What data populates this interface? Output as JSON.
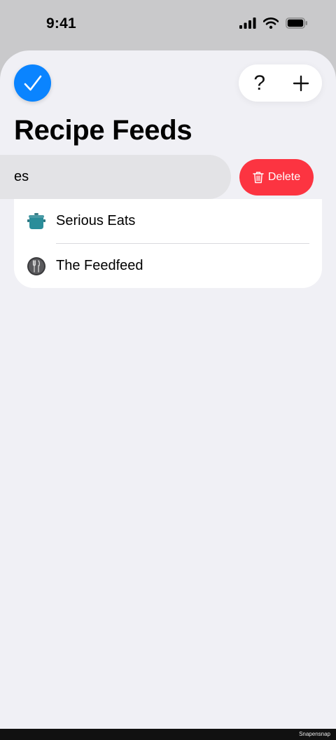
{
  "status_bar": {
    "time": "9:41",
    "icons": [
      "cellular-signal-icon",
      "wifi-icon",
      "battery-icon"
    ]
  },
  "toolbar": {
    "done_icon": "checkmark-icon",
    "help_label": "?",
    "add_label": "+"
  },
  "page": {
    "title": "Recipe Feeds"
  },
  "swiped_row": {
    "visible_text": "es"
  },
  "delete_action": {
    "label": "Delete",
    "icon": "trash-icon"
  },
  "feeds": [
    {
      "name": "Serious Eats",
      "icon": "cooking-pot-icon"
    },
    {
      "name": "The Feedfeed",
      "icon": "utensils-icon"
    }
  ],
  "footer": {
    "watermark": "Snapensnap"
  },
  "colors": {
    "accent": "#0a84ff",
    "destructive": "#fc3441",
    "background": "#f0f0f5",
    "card": "#ffffff"
  }
}
